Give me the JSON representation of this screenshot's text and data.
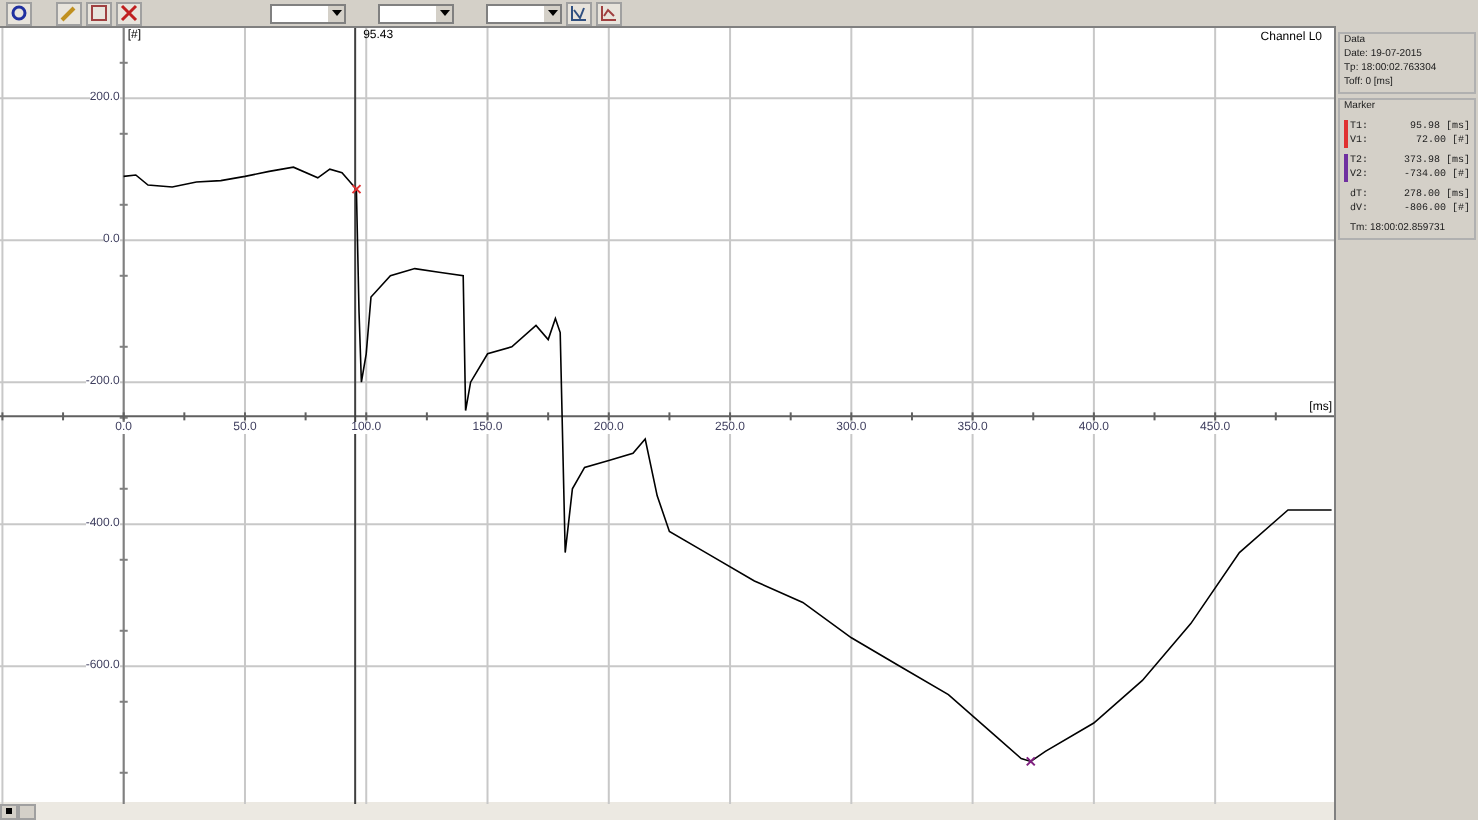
{
  "chart": {
    "unit_y": "[#]",
    "unit_x": "[ms]",
    "chart_data": {
      "type": "line",
      "grid": true,
      "xlim": [
        -51,
        499
      ],
      "ylim": [
        -794,
        299
      ],
      "xticks": [
        {
          "value": 0,
          "label": "0.0"
        },
        {
          "value": 50,
          "label": "50.0"
        },
        {
          "value": 100,
          "label": "100.0"
        },
        {
          "value": 150,
          "label": "150.0"
        },
        {
          "value": 200,
          "label": "200.0"
        },
        {
          "value": 250,
          "label": "250.0"
        },
        {
          "value": 300,
          "label": "300.0"
        },
        {
          "value": 350,
          "label": "350.0"
        },
        {
          "value": 400,
          "label": "400.0"
        },
        {
          "value": 450,
          "label": "450.0"
        }
      ],
      "yticks": [
        {
          "value": 200,
          "label": "200.0"
        },
        {
          "value": 0,
          "label": "0.0"
        },
        {
          "value": -200,
          "label": "-200.0"
        },
        {
          "value": -400,
          "label": "-400.0"
        },
        {
          "value": -600,
          "label": "-600.0"
        }
      ],
      "x": [
        0,
        5,
        10,
        20,
        30,
        40,
        50,
        60,
        70,
        80,
        85,
        90,
        95.98,
        97,
        98,
        100,
        102,
        110,
        120,
        130,
        140,
        141,
        143,
        150,
        160,
        170,
        175,
        178,
        180,
        182,
        185,
        190,
        200,
        210,
        215,
        220,
        225,
        240,
        260,
        280,
        300,
        320,
        340,
        360,
        370,
        373.98,
        380,
        400,
        420,
        440,
        460,
        480,
        498
      ],
      "series": [
        {
          "name": "Channel L0",
          "color": "#000000",
          "values": [
            90,
            92,
            78,
            75,
            82,
            84,
            90,
            97,
            103,
            88,
            100,
            95,
            72,
            -100,
            -200,
            -160,
            -80,
            -50,
            -40,
            -45,
            -50,
            -240,
            -200,
            -160,
            -150,
            -120,
            -140,
            -110,
            -130,
            -440,
            -350,
            -320,
            -310,
            -300,
            -280,
            -360,
            -410,
            -440,
            -480,
            -510,
            -560,
            -600,
            -640,
            -700,
            -730,
            -734,
            -720,
            -680,
            -620,
            -540,
            -440,
            -380,
            -380
          ]
        },
        {
          "color": "#e03030",
          "marker": "x",
          "values": [
            null,
            null,
            null,
            null,
            null,
            null,
            null,
            null,
            null,
            null,
            null,
            null,
            72,
            null,
            null,
            null,
            null,
            null,
            null,
            null,
            null,
            null,
            null,
            null,
            null,
            null,
            null,
            null,
            null,
            null,
            null,
            null,
            null,
            null,
            null,
            null,
            null,
            null,
            null,
            null,
            null,
            null,
            null,
            null,
            null,
            null,
            null,
            null,
            null,
            null,
            null,
            null,
            null
          ]
        },
        {
          "color": "#802080",
          "marker": "x",
          "values": [
            null,
            null,
            null,
            null,
            null,
            null,
            null,
            null,
            null,
            null,
            null,
            null,
            null,
            null,
            null,
            null,
            null,
            null,
            null,
            null,
            null,
            null,
            null,
            null,
            null,
            null,
            null,
            null,
            null,
            null,
            null,
            null,
            null,
            null,
            null,
            null,
            null,
            null,
            null,
            null,
            null,
            null,
            null,
            null,
            null,
            -734,
            null,
            null,
            null,
            null,
            null,
            null,
            null
          ]
        }
      ],
      "ref_lines": [
        {
          "axis": "x",
          "value": 95.43,
          "label": "95.43"
        }
      ]
    }
  },
  "panel": {
    "data": {
      "title": "Data",
      "lines": [
        "Date: 19-07-2015",
        "Tp: 18:00:02.763304",
        "Toff: 0 [ms]"
      ]
    },
    "marker": {
      "title": "Marker",
      "groups": [
        {
          "color": "#e03030",
          "rows": [
            {
              "label": "T1:",
              "value": "95.98 [ms]"
            },
            {
              "label": "V1:",
              "value": "72.00 [#]"
            }
          ]
        },
        {
          "color": "#7030a0",
          "rows": [
            {
              "label": "T2:",
              "value": "373.98 [ms]"
            },
            {
              "label": "V2:",
              "value": "-734.00 [#]"
            }
          ]
        }
      ],
      "diff": [
        {
          "label": "dT:",
          "value": "278.00 [ms]"
        },
        {
          "label": "dV:",
          "value": "-806.00 [#]"
        }
      ],
      "tm": "Tm: 18:00:02.859731"
    }
  }
}
